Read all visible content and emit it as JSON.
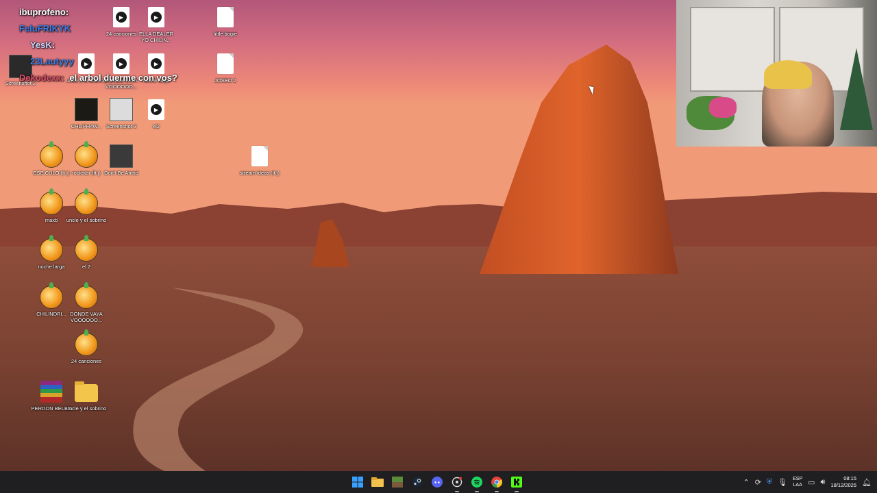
{
  "chat": [
    {
      "nick": "ibuprofeno:",
      "msg": "",
      "color": "#ffffff"
    },
    {
      "nick": "FeluFRIKYK",
      "msg": "",
      "color": "#3d7fe8"
    },
    {
      "nick": "YesK:",
      "msg": "",
      "color": "#d0d8ff"
    },
    {
      "nick": "23Lautyyy",
      "msg": "",
      "color": "#3d7fe8"
    },
    {
      "nick": "Dekodexx:",
      "msg": "el arbol duerme con vos?",
      "color": "#e0506a"
    }
  ],
  "icons": {
    "i1": "Screenshot 2",
    "i2": "24 canciones",
    "i3": "ELLA DEALER YO CHILIN...",
    "i4": "little bogie",
    "i5": "uncle y el sobrino",
    "i6": "DONDE VAYA VOOOOOO...",
    "i7": "noche larga",
    "i8": "JOSEO 2",
    "i9": "CHLIPH4W...",
    "i10": "Screenshot 3",
    "i11": "el2",
    "i12": "ESE CULO (ft j)",
    "i13": "rockstar (ft j)",
    "i14": "Don't Be Afraid",
    "i15": "stream ideas (ft j)",
    "i16": "maxb",
    "i17": "uncle y el sobrino",
    "i18": "noche larga",
    "i19": "el 2",
    "i20": "CHILINDRI...",
    "i21": "DONDE VAYA VOOOOOO...",
    "i22": "24 canciones",
    "i23": "PERDON BELEN ...",
    "i24": "uncle y el sobrino"
  },
  "taskbar": {
    "apps": [
      "windows-start",
      "file-explorer",
      "minecraft",
      "steam",
      "discord",
      "chatgpt",
      "spotify",
      "chrome",
      "kick"
    ],
    "lang_top": "ESP",
    "lang_bottom": "LAA",
    "time": "08:15",
    "date": "18/12/2025"
  }
}
